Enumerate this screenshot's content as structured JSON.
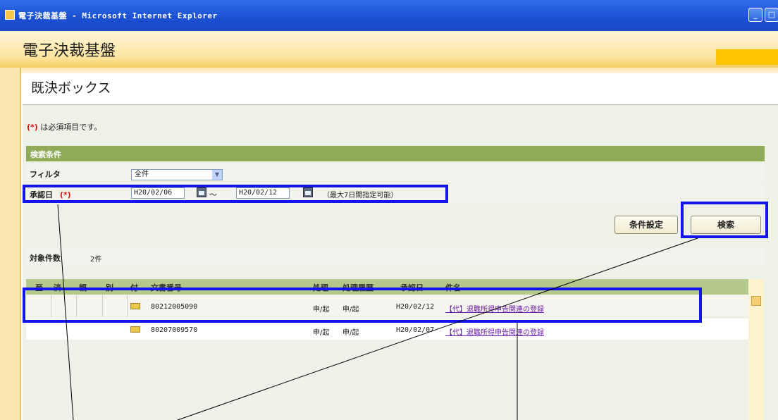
{
  "window": {
    "title": "電子決裁基盤 - Microsoft Internet Explorer"
  },
  "app": {
    "title": "電子決裁基盤"
  },
  "page": {
    "title": "既決ボックス"
  },
  "required_note": {
    "mark": "(*)",
    "text": " は必須項目です。"
  },
  "search": {
    "header": "検索条件",
    "filter_label": "フィルタ",
    "filter_value": "全件",
    "date_label": "承認日",
    "date_required_mark": "(*)",
    "date_from": "H20/02/06",
    "date_to": "H20/02/12",
    "tilde": "～",
    "range_note": "（最大7日間指定可能）",
    "settings_button": "条件設定",
    "search_button": "検索"
  },
  "result": {
    "count_label": "対象件数",
    "count_value": "2件",
    "columns": [
      "至",
      "済",
      "親",
      "別",
      "付",
      "文書番号",
      "処理",
      "処理履歴",
      "承認日",
      "件名"
    ],
    "rows": [
      {
        "doc_no": "80212005090",
        "process": "申/起",
        "history": "申/起",
        "date": "H20/02/12",
        "subject": "【代】退職所得申告関連の登録"
      },
      {
        "doc_no": "80207009570",
        "process": "申/起",
        "history": "申/起",
        "date": "H20/02/07",
        "subject": "【代】退職所得申告関連の登録"
      }
    ]
  },
  "colors": {
    "highlight": "#1414ee",
    "header_green": "#8fab57",
    "banner": "#fde6a3",
    "link": "#6b1fa6"
  }
}
